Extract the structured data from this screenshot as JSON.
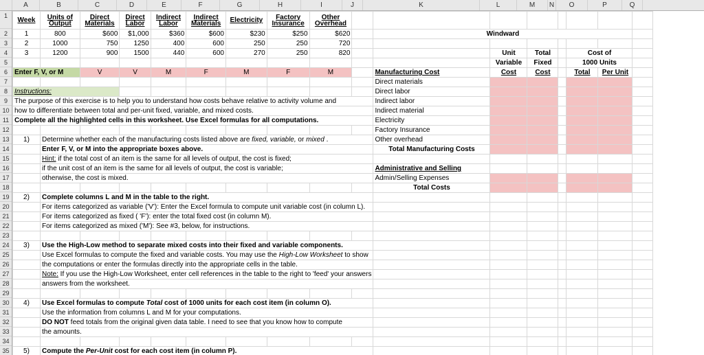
{
  "columns": [
    "A",
    "B",
    "C",
    "D",
    "E",
    "F",
    "G",
    "H",
    "I",
    "J",
    "K",
    "L",
    "M",
    "N",
    "O",
    "P",
    "Q"
  ],
  "rowCount": 35,
  "headers": {
    "week": "Week",
    "units": "Units of",
    "output": "Output",
    "directMat": "Direct",
    "materials": "Materials",
    "directLab": "Direct",
    "labor": "Labor",
    "indirectLab": "Indirect",
    "labor2": "Labor",
    "indirectMat": "Indirect",
    "materials2": "Materials",
    "electricity": "Electricity",
    "factory": "Factory",
    "insurance": "Insurance",
    "other": "Other",
    "overhead": "Overhead"
  },
  "dataRows": [
    {
      "week": "1",
      "units": "800",
      "dm": "$600",
      "dl": "$1,000",
      "il": "$360",
      "im": "$600",
      "el": "$230",
      "fi": "$250",
      "oh": "$620"
    },
    {
      "week": "2",
      "units": "1000",
      "dm": "750",
      "dl": "1250",
      "il": "400",
      "im": "600",
      "el": "250",
      "fi": "250",
      "oh": "720"
    },
    {
      "week": "3",
      "units": "1200",
      "dm": "900",
      "dl": "1500",
      "il": "440",
      "im": "600",
      "el": "270",
      "fi": "250",
      "oh": "820"
    }
  ],
  "fvmRow": {
    "label": "Enter F, V, or M",
    "c": "V",
    "d": "V",
    "e": "M",
    "f": "F",
    "g": "M",
    "h": "F",
    "i": "M"
  },
  "instructions": {
    "title": "Instructions:",
    "p1": "The purpose of this exercise is to help you to understand how costs behave relative to activity volume and",
    "p2": "how to differentiate between total and per-unit fixed, variable, and mixed costs.",
    "p3": "Complete all the highlighted cells in this worksheet. Use Excel formulas for all computations."
  },
  "step1": {
    "num": "1)",
    "l1": "Determine whether each of the manufacturing costs listed above are fixed, variable, or mixed .",
    "l2": "Enter F, V, or M into the appropriate boxes above.",
    "l3": "Hint: if the total  cost of an item is the same for all levels of output, the cost is fixed;",
    "l4": "if the unit cost of an item is the same for all levels of output, the cost is variable;",
    "l5": "otherwise, the cost is mixed."
  },
  "step2": {
    "num": "2)",
    "l1": "Complete columns L and M in the table to the right.",
    "l2": "For items categorized as variable ('V'): Enter the Excel formula to compute unit variable cost (in column L).",
    "l3": "For items categorized as fixed ( 'F'): enter the total fixed cost (in column M).",
    "l4": "For items categorized as mixed ('M'): See #3, below, for instructions."
  },
  "step3": {
    "num": "3)",
    "l1": "Use the High-Low method to separate mixed costs into their fixed and variable components.",
    "l2": "Use Excel formulas to compute the fixed and variable costs. You may use the High-Low Worksheet to show",
    "l3": "the computations or enter the formulas directly into the appropriate cells in the table.",
    "l4": "Note: If you use the High-Low Worksheet, enter cell references in the table to the right to 'feed' your answers",
    "l5": "answers from the worksheet."
  },
  "step4": {
    "num": "4)",
    "l1": "Use Excel formulas to compute Total cost of 1000 units for each cost item (in column O).",
    "l2": "Use the information from columns L and M for your computations.",
    "l3": "DO NOT feed totals from the original given data table. I need to see that you know how to compute",
    "l4": "the amounts."
  },
  "step5": {
    "num": "5)",
    "l1": "Compute the Per-Unit cost for each cost item (in column P)."
  },
  "right": {
    "title": "Windward",
    "unit": "Unit",
    "total": "Total",
    "costof": "Cost of",
    "variable": "Variable",
    "fixed": "Fixed",
    "units1000": "1000 Units",
    "cost": "Cost",
    "cost2": "Cost",
    "total2": "Total",
    "perUnit": "Per Unit",
    "mfg": "Manufacturing Cost",
    "dm": "Direct materials",
    "dl": "Direct labor",
    "il": "Indirect labor",
    "im": "Indirect material",
    "el": "Electricity",
    "fi": "Factory Insurance",
    "oh": "Other overhead",
    "tmc": "Total Manufacturing Costs",
    "admin": "Administrative and Selling",
    "adminExp": "Admin/Selling Expenses",
    "tc": "Total Costs"
  }
}
